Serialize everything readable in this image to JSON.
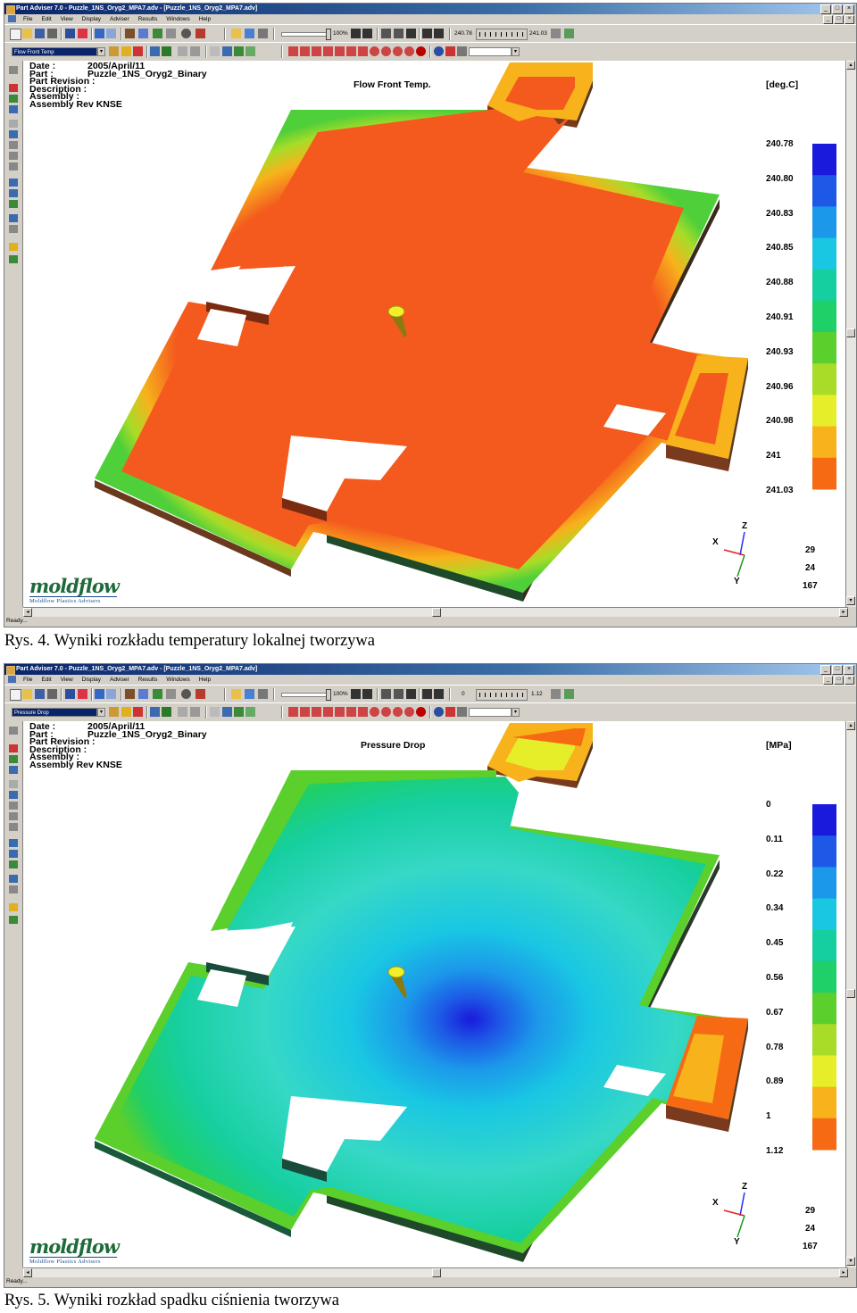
{
  "figures": [
    {
      "window_title": "Part Adviser 7.0 - Puzzle_1NS_Oryg2_MPA7.adv - [Puzzle_1NS_Oryg2_MPA7.adv]",
      "menu": [
        "File",
        "Edit",
        "View",
        "Display",
        "Adviser",
        "Results",
        "Windows",
        "Help"
      ],
      "zoom": "100%",
      "range_min": "240.78",
      "range_max": "241.03",
      "result_selector": "Flow Front Temp",
      "info": {
        "date_label": "Date :",
        "date_value": "2005/April/11",
        "part_label": "Part :",
        "part_value": "Puzzle_1NS_Oryg2_Binary",
        "revision_label": "Part Revision :",
        "description_label": "Description :",
        "assembly_label": "Assembly :",
        "assembly_rev_label": "Assembly Rev KNSE"
      },
      "plot_title": "Flow Front Temp.",
      "unit": "[deg.C]",
      "legend_values": [
        "240.78",
        "240.80",
        "240.83",
        "240.85",
        "240.88",
        "240.91",
        "240.93",
        "240.96",
        "240.98",
        "241",
        "241.03"
      ],
      "legend_colors": [
        "#1a1adc",
        "#1d58e6",
        "#1c98ea",
        "#19c7e3",
        "#16cfa0",
        "#1fcf68",
        "#5bcf2c",
        "#a8dc28",
        "#e6ee2a",
        "#f7b21c",
        "#f66a14"
      ],
      "axis": {
        "x": "X",
        "y": "Y",
        "z": "Z"
      },
      "view_numbers": [
        "29",
        "24",
        "167"
      ],
      "logo_text": "moldflow",
      "logo_sub": "Moldflow Plastics Advisers",
      "status": "Ready...",
      "plate_fill": "#f45a1e",
      "caption": "Rys. 4. Wyniki rozkładu temperatury lokalnej tworzywa"
    },
    {
      "window_title": "Part Adviser 7.0 - Puzzle_1NS_Oryg2_MPA7.adv - [Puzzle_1NS_Oryg2_MPA7.adv]",
      "menu": [
        "File",
        "Edit",
        "View",
        "Display",
        "Adviser",
        "Results",
        "Windows",
        "Help"
      ],
      "zoom": "100%",
      "range_min": "0",
      "range_max": "1.12",
      "result_selector": "Pressure Drop",
      "info": {
        "date_label": "Date :",
        "date_value": "2005/April/11",
        "part_label": "Part :",
        "part_value": "Puzzle_1NS_Oryg2_Binary",
        "revision_label": "Part Revision :",
        "description_label": "Description :",
        "assembly_label": "Assembly :",
        "assembly_rev_label": "Assembly Rev KNSE"
      },
      "plot_title": "Pressure Drop",
      "unit": "[MPa]",
      "legend_values": [
        "0",
        "0.11",
        "0.22",
        "0.34",
        "0.45",
        "0.56",
        "0.67",
        "0.78",
        "0.89",
        "1",
        "1.12"
      ],
      "legend_colors": [
        "#1a1adc",
        "#1d58e6",
        "#1c98ea",
        "#19c7e3",
        "#16cfa0",
        "#1fcf68",
        "#5bcf2c",
        "#a8dc28",
        "#e6ee2a",
        "#f7b21c",
        "#f66a14"
      ],
      "axis": {
        "x": "X",
        "y": "Y",
        "z": "Z"
      },
      "view_numbers": [
        "29",
        "24",
        "167"
      ],
      "logo_text": "moldflow",
      "logo_sub": "Moldflow Plastics Advisers",
      "status": "Ready...",
      "plate_fill": "#36d8c6",
      "caption": "Rys. 5. Wyniki rozkład spadku ciśnienia tworzywa"
    }
  ]
}
